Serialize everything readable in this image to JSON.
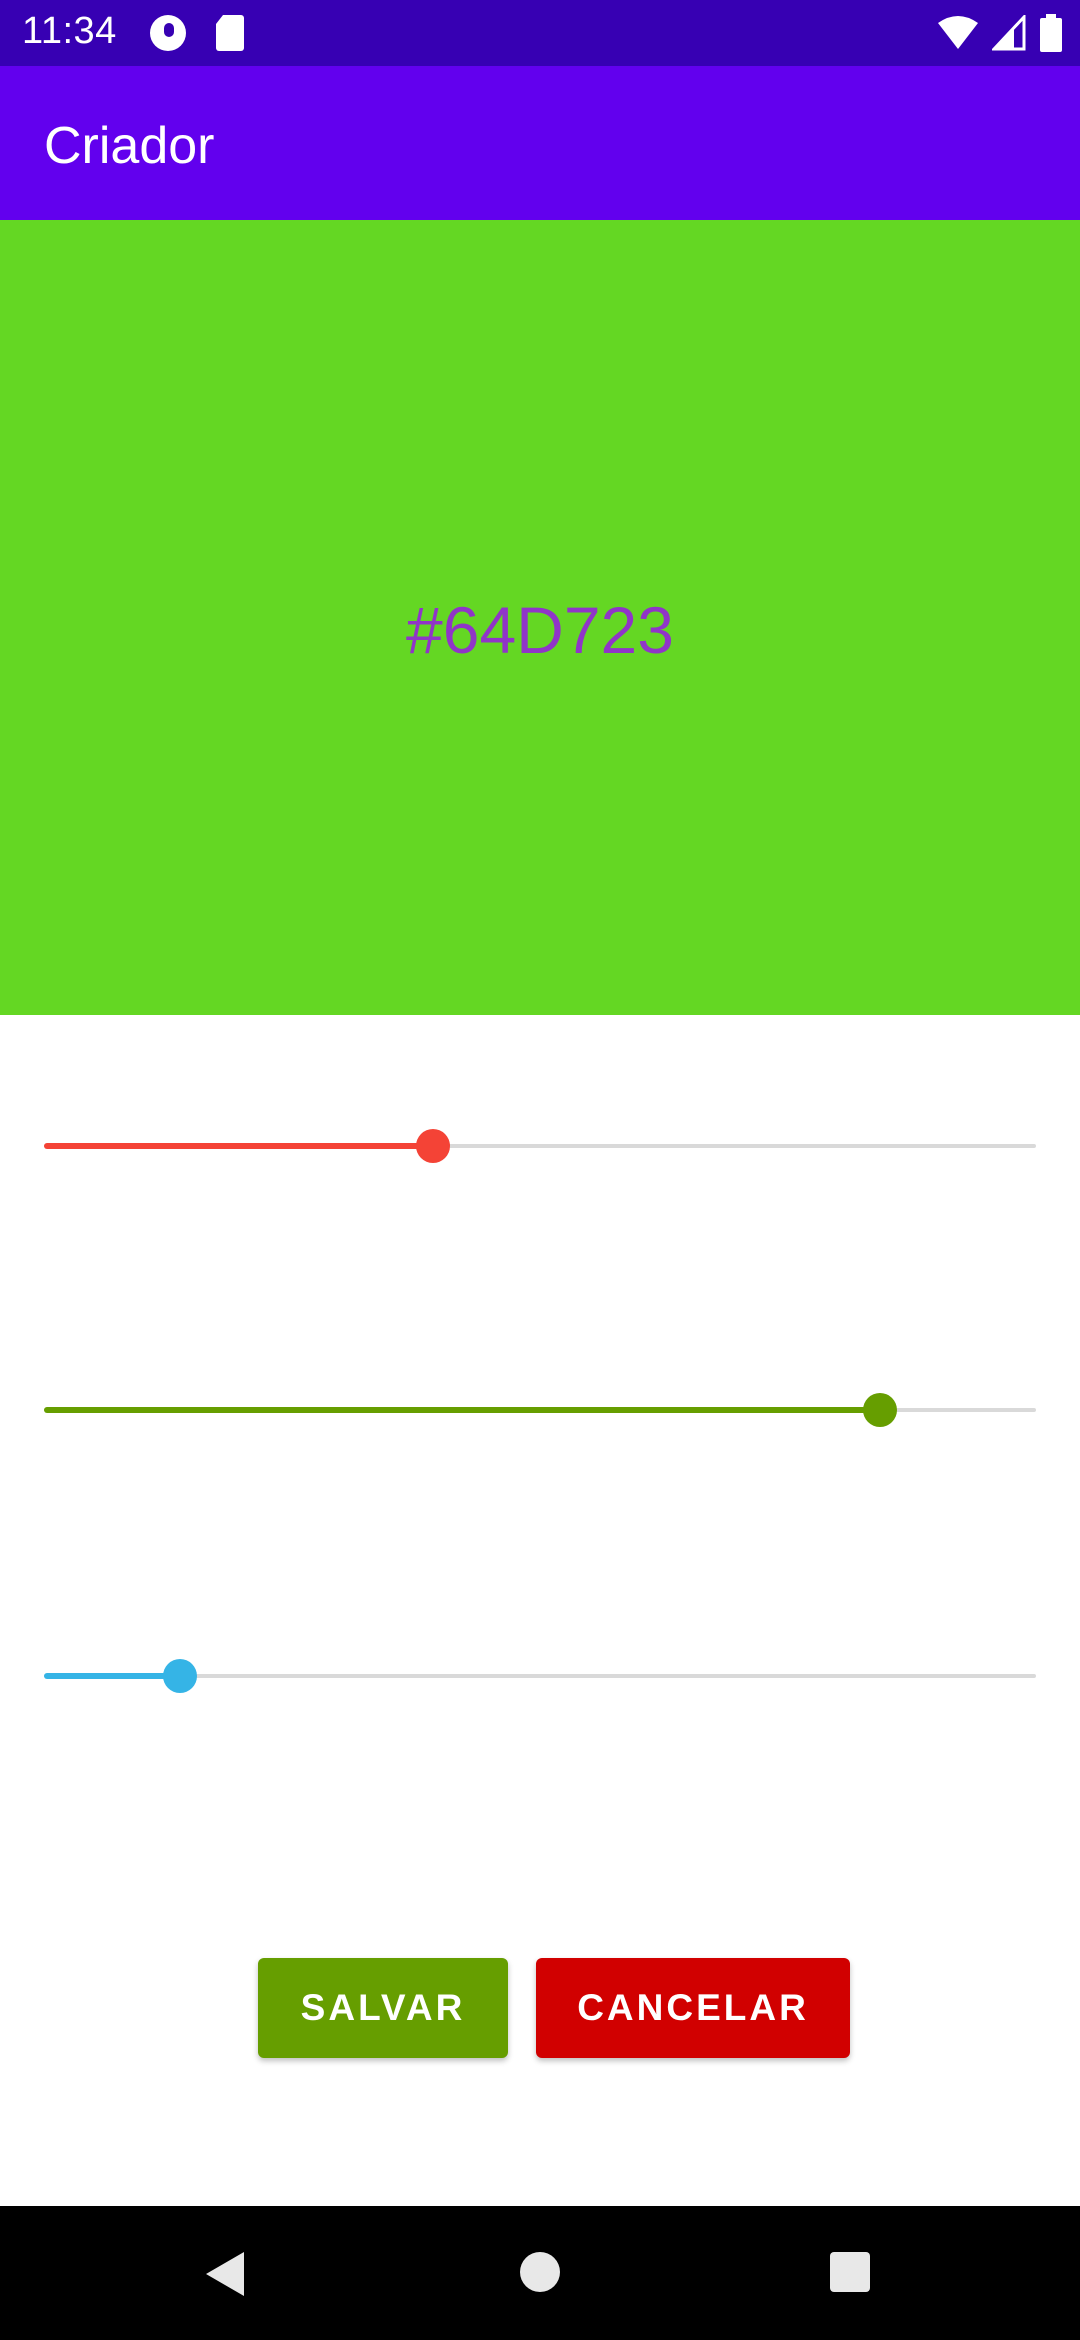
{
  "status_bar": {
    "time": "11:34",
    "icons": [
      "sync-icon",
      "sd-card-icon",
      "wifi-icon",
      "signal-icon",
      "battery-icon"
    ]
  },
  "app_bar": {
    "title": "Criador"
  },
  "preview": {
    "hex": "#64D723",
    "background_color": "#64D723",
    "text_color": "#9035C8"
  },
  "sliders": [
    {
      "channel": "red",
      "value_fraction": 0.392,
      "color": "#F44336"
    },
    {
      "channel": "green",
      "value_fraction": 0.843,
      "color": "#669E00"
    },
    {
      "channel": "blue",
      "value_fraction": 0.137,
      "color": "#35B4E6"
    }
  ],
  "buttons": {
    "save_label": "SALVAR",
    "cancel_label": "CANCELAR",
    "save_color": "#669E00",
    "cancel_color": "#D10000"
  },
  "nav_bar": {
    "icons": [
      "back-icon",
      "home-icon",
      "recents-icon"
    ]
  }
}
